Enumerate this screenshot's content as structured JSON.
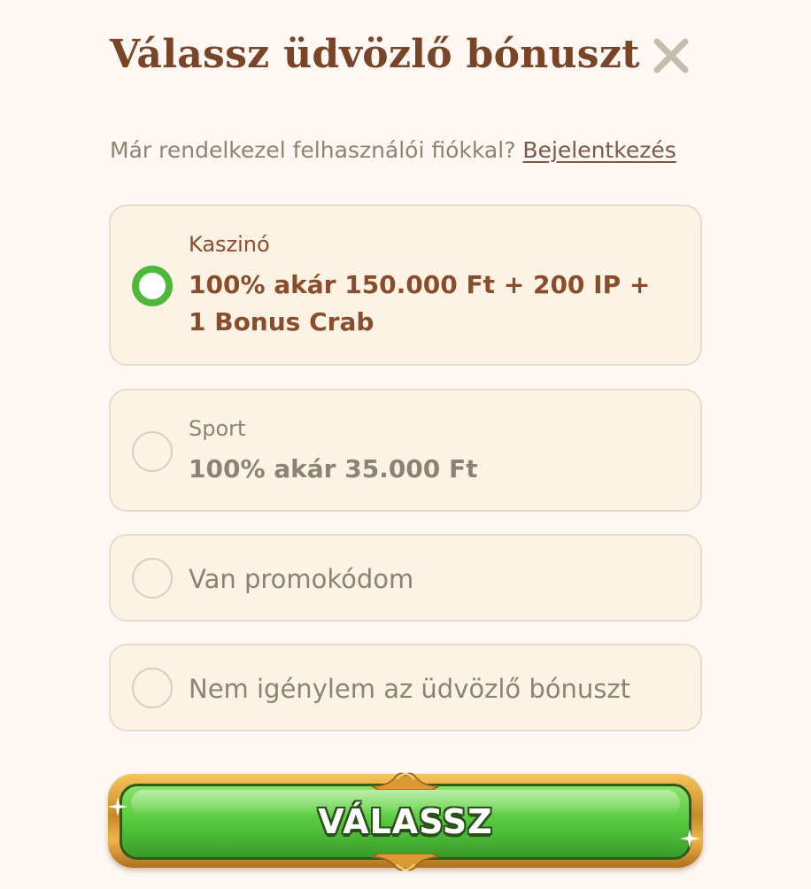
{
  "modal": {
    "title": "Válassz üdvözlő bónuszt",
    "close_icon": "close-icon"
  },
  "login_prompt": {
    "text": "Már rendelkezel felhasználói fiókkal? ",
    "link": "Bejelentkezés"
  },
  "options": [
    {
      "category": "Kaszinó",
      "detail": "100% akár 150.000 Ft + 200 IP + 1 Bonus Crab",
      "selected": true
    },
    {
      "category": "Sport",
      "detail": "100% akár 35.000 Ft",
      "selected": false
    },
    {
      "label": "Van promokódom",
      "selected": false
    },
    {
      "label": "Nem igénylem az üdvözlő bónuszt",
      "selected": false
    }
  ],
  "cta": {
    "label": "VÁLASSZ"
  },
  "colors": {
    "background": "#fdf8f4",
    "title": "#7a4426",
    "option_bg": "#fdf3e4",
    "radio_selected": "#4db83a",
    "cta_green": "#5fcf45",
    "cta_gold": "#c9892a"
  }
}
